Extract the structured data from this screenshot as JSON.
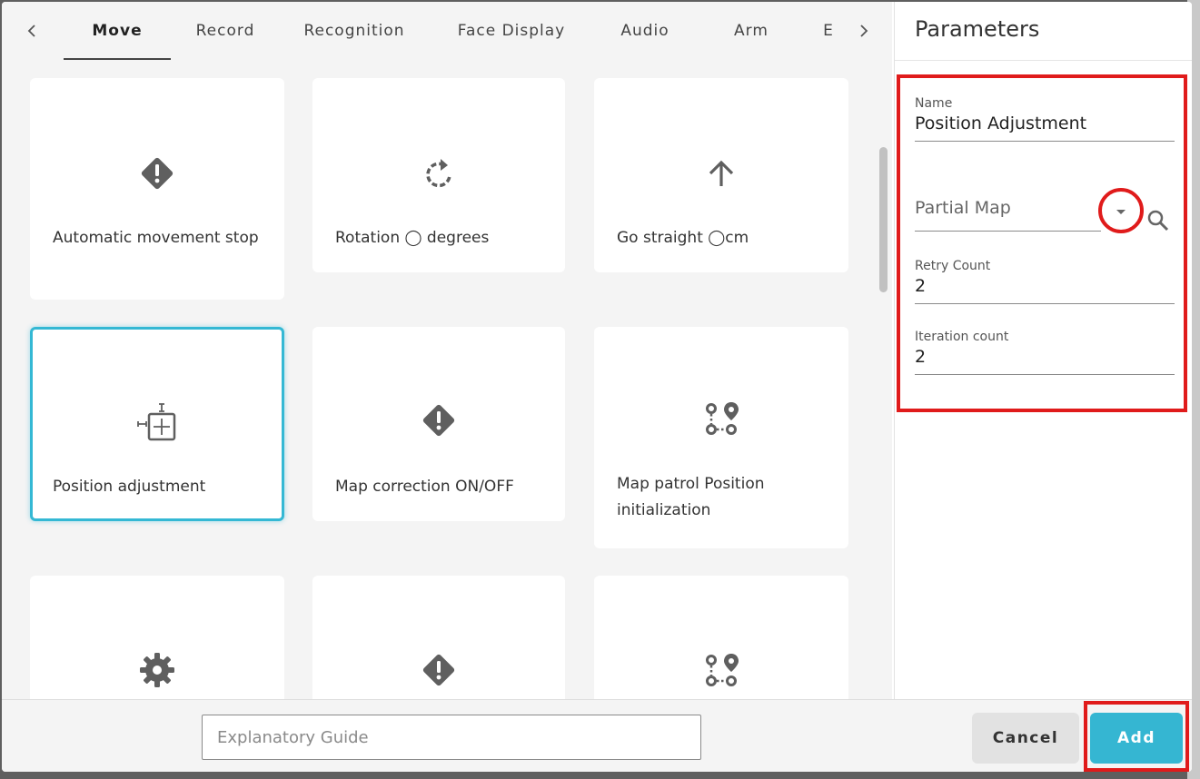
{
  "tabs": {
    "prev_icon": "chevron-left-icon",
    "next_icon": "chevron-right-icon",
    "items": [
      {
        "label": "Move",
        "active": true
      },
      {
        "label": "Record"
      },
      {
        "label": "Recognition"
      },
      {
        "label": "Face Display"
      },
      {
        "label": "Audio"
      },
      {
        "label": "Arm"
      },
      {
        "label": "E"
      }
    ]
  },
  "cards": [
    {
      "label": "Automatic movement stop",
      "icon": "warning-diamond-icon"
    },
    {
      "label": "Rotation ◯ degrees",
      "icon": "rotate-icon"
    },
    {
      "label": "Go straight ◯cm",
      "icon": "arrow-up-icon"
    },
    {
      "label": "Position adjustment",
      "icon": "position-adjust-icon",
      "selected": true
    },
    {
      "label": "Map correction ON/OFF",
      "icon": "warning-diamond-icon"
    },
    {
      "label": "Map patrol Position initialization",
      "icon": "route-icon"
    },
    {
      "label": "",
      "icon": "gear-icon"
    },
    {
      "label": "",
      "icon": "warning-diamond-icon"
    },
    {
      "label": "",
      "icon": "route-icon"
    }
  ],
  "parameters": {
    "title": "Parameters",
    "name_label": "Name",
    "name_value": "Position Adjustment",
    "map_select_value": "Partial Map",
    "retry_label": "Retry Count",
    "retry_value": "2",
    "iteration_label": "Iteration count",
    "iteration_value": "2"
  },
  "footer": {
    "guide_placeholder": "Explanatory Guide",
    "cancel_label": "Cancel",
    "add_label": "Add"
  },
  "colors": {
    "accent": "#35b6d2",
    "highlight": "#e01b1b",
    "icon": "#5f5f5f"
  }
}
